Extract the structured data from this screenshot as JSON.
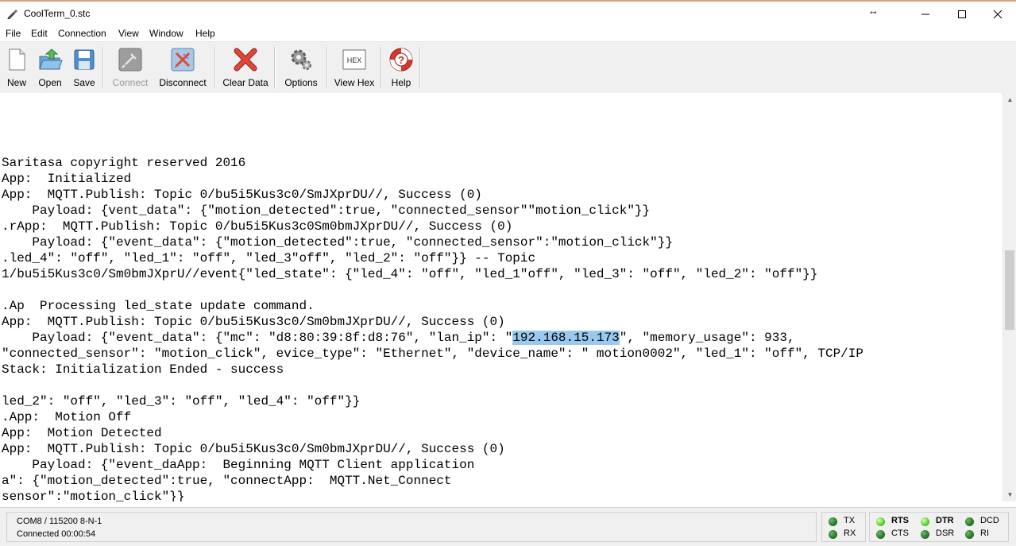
{
  "window": {
    "title": "CoolTerm_0.stc",
    "resize_glyph": "↔",
    "minimize": "—",
    "maximize": "☐",
    "close": "✕"
  },
  "menu": [
    "File",
    "Edit",
    "Connection",
    "View",
    "Window",
    "Help"
  ],
  "toolbar": {
    "new_label": "New",
    "open_label": "Open",
    "save_label": "Save",
    "connect_label": "Connect",
    "disconnect_label": "Disconnect",
    "clear_label": "Clear Data",
    "options_label": "Options",
    "viewhex_label": "View Hex",
    "viewhex_icon_text": "HEX",
    "help_label": "Help"
  },
  "terminal": {
    "lines": [
      "Saritasa copyright reserved 2016",
      "App:  Initialized",
      "App:  MQTT.Publish: Topic 0/bu5i5Kus3c0/SmJXprDU//, Success (0)",
      "    Payload: {vent_data\": {\"motion_detected\":true, \"connected_sensor\"\"motion_click\"}}",
      ".rApp:  MQTT.Publish: Topic 0/bu5i5Kus3c0Sm0bmJXprDU//, Success (0)",
      "    Payload: {\"event_data\": {\"motion_detected\":true, \"connected_sensor\":\"motion_click\"}}",
      ".led_4\": \"off\", \"led_1\": \"off\", \"led_3\"off\", \"led_2\": \"off\"}} -- Topic",
      "1/bu5i5Kus3c0/Sm0bmJXprU//event{\"led_state\": {\"led_4\": \"off\", \"led_1\"off\", \"led_3\": \"off\", \"led_2\": \"off\"}}",
      "",
      ".Ap  Processing led_state update command.",
      "App:  MQTT.Publish: Topic 0/bu5i5Kus3c0/Sm0bmJXprDU//, Success (0)",
      "    Payload: {\"event_data\": {\"mc\": \"d8:80:39:8f:d8:76\", \"lan_ip\": \"",
      "\"connected_sensor\": \"motion_click\", evice_type\": \"Ethernet\", \"device_name\": \" motion0002\", \"led_1\": \"off\", TCP/IP",
      "Stack: Initialization Ended - success",
      "",
      "led_2\": \"off\", \"led_3\": \"off\", \"led_4\": \"off\"}}",
      ".App:  Motion Off",
      "App:  Motion Detected",
      "App:  MQTT.Publish: Topic 0/bu5i5Kus3c0/Sm0bmJXprDU//, Success (0)",
      "    Payload: {\"event_daApp:  Beginning MQTT Client application",
      "a\": {\"motion_detected\":true, \"connectApp:  MQTT.Net_Connect",
      "sensor\":\"motion_click\"}}"
    ],
    "selected_text": "192.168.15.173",
    "after_selection": "\", \"memory_usage\": 933,"
  },
  "status": {
    "port_settings": "COM8 / 115200 8-N-1",
    "connection": "Connected 00:00:54",
    "leds": {
      "tx": "TX",
      "rx": "RX",
      "rts": "RTS",
      "cts": "CTS",
      "dtr": "DTR",
      "dsr": "DSR",
      "dcd": "DCD",
      "ri": "RI"
    }
  },
  "colors": {
    "selection": "#99c9ef",
    "led_on": "#3fc51f",
    "led_off": "#1c6b1c"
  }
}
